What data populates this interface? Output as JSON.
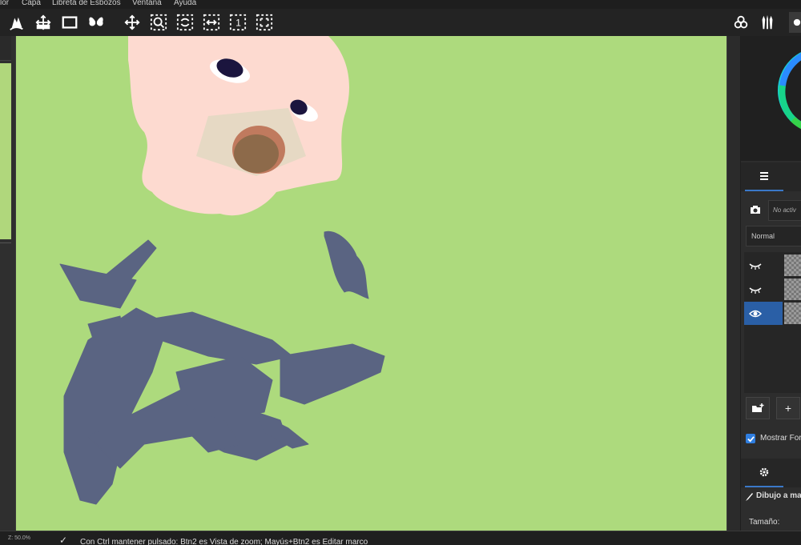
{
  "menu": [
    "lor",
    "Capa",
    "Libreta de Esbozos",
    "Ventana",
    "Ayuda"
  ],
  "toolbar": {
    "left_tools": [
      "hand-draw-icon",
      "transform-icon",
      "frame-icon",
      "butterfly-icon"
    ],
    "view_tools": [
      "move-view-icon",
      "zoom-icon",
      "rotate-view-icon",
      "fit-width-icon",
      "actual-size-icon",
      "fit-screen-icon"
    ],
    "actual_size_label": "1",
    "right_tools": [
      "color-circles-icon",
      "brushes-icon"
    ]
  },
  "layers_panel": {
    "no_active_label": "No activ",
    "blend_mode": "Normal",
    "layers": [
      {
        "visible": false,
        "selected": false
      },
      {
        "visible": false,
        "selected": false
      },
      {
        "visible": true,
        "selected": true
      }
    ],
    "add_button_label": "+",
    "show_label": "Mostrar For",
    "show_checked": true
  },
  "brush_panel": {
    "title": "Dibujo a ma",
    "size_label": "Tamaño:"
  },
  "status": {
    "zoom": "Z: 50.0%",
    "hint": "Con Ctrl mantener pulsado: Btn2 es Vista de zoom; Mayús+Btn2 es Editar marco"
  },
  "colors": {
    "canvas_bg": "#adda7d",
    "pink": "#fddad0",
    "blue_gray": "#5a6482",
    "accent": "#2a5fa6"
  }
}
